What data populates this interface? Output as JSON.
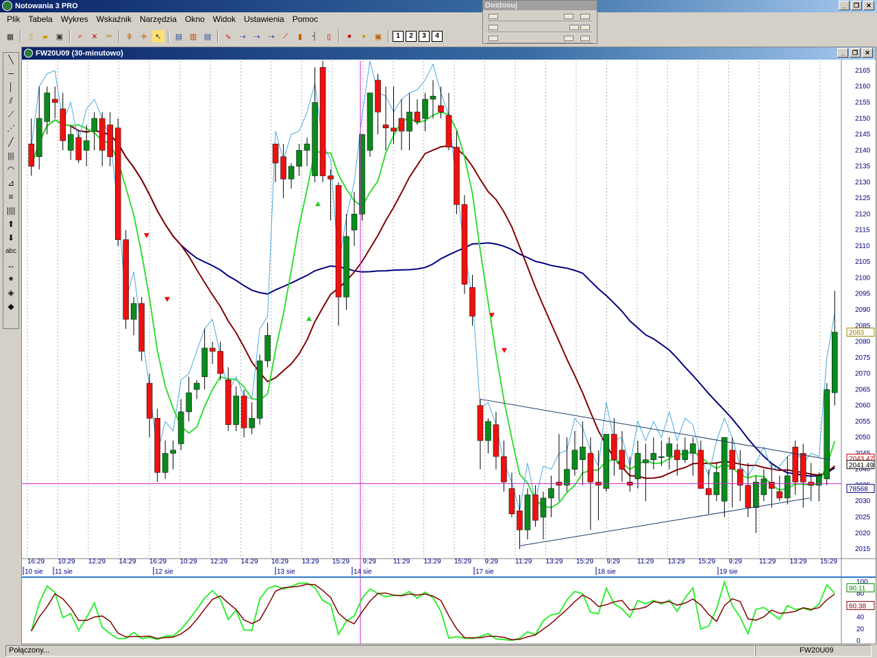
{
  "app": {
    "title": "Notowania 3 PRO",
    "window_buttons": [
      "_",
      "❐",
      "✕"
    ]
  },
  "menu": [
    "Plik",
    "Tabela",
    "Wykres",
    "Wskaźnik",
    "Narzędzia",
    "Okno",
    "Widok",
    "Ustawienia",
    "Pomoc"
  ],
  "toolbar": {
    "icons": [
      "grid-icon",
      "new-icon",
      "open-icon",
      "save-icon",
      "zoom-icon",
      "delete-icon",
      "ruler-icon",
      "fibonacci-icon",
      "crosshair-icon",
      "cursor-icon",
      "table-icon",
      "layout-icon",
      "list-icon",
      "wave-icon",
      "arrow-right-icon",
      "arrow-right-2-icon",
      "arrow-right-3-icon",
      "line-chart-icon",
      "bar-chart-icon",
      "ohlc-icon",
      "candle-icon",
      "signal-icon",
      "idea-icon",
      "picture-icon"
    ],
    "numbers": [
      "1",
      "2",
      "3",
      "4"
    ]
  },
  "adjust_panel": {
    "title": "Dostosuj"
  },
  "left_tools": [
    "line-icon",
    "horizontal-line-icon",
    "vertical-line-icon",
    "channel-icon",
    "trend-icon",
    "gann-fan-icon",
    "segment-icon",
    "parallel-lines-icon",
    "arc-icon",
    "fan-icon",
    "fibonacci-retracement-icon",
    "time-zones-icon",
    "arrow-up-icon",
    "arrow-down-icon",
    "text-icon",
    "measure-icon",
    "magnet-icon",
    "eraser-icon",
    "clear-icon"
  ],
  "chart_window": {
    "title": "FW20U09 (30-minutowo)",
    "window_buttons": [
      "_",
      "❐",
      "✕"
    ]
  },
  "chart_data": {
    "type": "candlestick",
    "instrument": "FW20U09",
    "interval": "30-minutowo",
    "ylim": [
      2012,
      2168
    ],
    "yticks": [
      2165,
      2160,
      2155,
      2150,
      2145,
      2140,
      2135,
      2130,
      2125,
      2120,
      2115,
      2110,
      2105,
      2100,
      2095,
      2090,
      2085,
      2080,
      2075,
      2070,
      2065,
      2060,
      2055,
      2050,
      2045,
      2040,
      2035,
      2030,
      2025,
      2020,
      2015
    ],
    "time_labels": [
      "16:29",
      "10:29",
      "12:29",
      "14:29",
      "16:29",
      "10:29",
      "12:29",
      "14:29",
      "16:29",
      "13:29",
      "15:29",
      "9:29",
      "11:29",
      "13:29",
      "15:29",
      "9:29",
      "11:29",
      "13:29",
      "15:29",
      "9:29",
      "11:29",
      "13:29",
      "15:29",
      "9:29",
      "11:29",
      "13:29",
      "15:29"
    ],
    "date_labels": [
      "10 sie",
      "11 sie",
      "12 sie",
      "13 sie",
      "14 sie",
      "17 sie",
      "18 sie",
      "19 sie"
    ],
    "price_badges": {
      "last": "2083",
      "ma_red": "2043.47",
      "ma_black": "2041.49",
      "volume": "78568"
    },
    "candles": [
      [
        2142,
        2150,
        2132,
        2135
      ],
      [
        2138,
        2160,
        2134,
        2150
      ],
      [
        2149,
        2160,
        2145,
        2158
      ],
      [
        2156,
        2160,
        2150,
        2155
      ],
      [
        2153,
        2158,
        2140,
        2143
      ],
      [
        2140,
        2148,
        2137,
        2145
      ],
      [
        2144,
        2146,
        2136,
        2137
      ],
      [
        2140,
        2148,
        2135,
        2143
      ],
      [
        2146,
        2152,
        2140,
        2150
      ],
      [
        2150,
        2152,
        2135,
        2140
      ],
      [
        2148,
        2152,
        2135,
        2138
      ],
      [
        2147,
        2150,
        2110,
        2112
      ],
      [
        2112,
        2115,
        2084,
        2087
      ],
      [
        2087,
        2094,
        2082,
        2092
      ],
      [
        2092,
        2094,
        2074,
        2077
      ],
      [
        2067,
        2070,
        2050,
        2056
      ],
      [
        2056,
        2059,
        2036,
        2039
      ],
      [
        2039,
        2049,
        2037,
        2045
      ],
      [
        2045,
        2049,
        2040,
        2046
      ],
      [
        2048,
        2062,
        2046,
        2058
      ],
      [
        2058,
        2069,
        2055,
        2064
      ],
      [
        2065,
        2068,
        2062,
        2067
      ],
      [
        2069,
        2084,
        2065,
        2078
      ],
      [
        2078,
        2080,
        2073,
        2077
      ],
      [
        2077,
        2080,
        2068,
        2070
      ],
      [
        2068,
        2072,
        2052,
        2054
      ],
      [
        2054,
        2066,
        2052,
        2063
      ],
      [
        2063,
        2065,
        2050,
        2053
      ],
      [
        2053,
        2061,
        2051,
        2056
      ],
      [
        2056,
        2076,
        2054,
        2074
      ],
      [
        2074,
        2086,
        2072,
        2082
      ],
      [
        2142,
        2142,
        2130,
        2136
      ],
      [
        2138,
        2142,
        2125,
        2131
      ],
      [
        2131,
        2136,
        2128,
        2135
      ],
      [
        2135,
        2142,
        2132,
        2140
      ],
      [
        2140,
        2144,
        2135,
        2142
      ],
      [
        2132,
        2166,
        2130,
        2155
      ],
      [
        2166,
        2168,
        2130,
        2132
      ],
      [
        2132,
        2134,
        2118,
        2131
      ],
      [
        2129,
        2130,
        2085,
        2094
      ],
      [
        2094,
        2120,
        2090,
        2113
      ],
      [
        2115,
        2127,
        2110,
        2120
      ],
      [
        2120,
        2144,
        2118,
        2145
      ],
      [
        2140,
        2158,
        2138,
        2158
      ],
      [
        2162,
        2164,
        2145,
        2152
      ],
      [
        2148,
        2160,
        2140,
        2147
      ],
      [
        2147,
        2160,
        2142,
        2146
      ],
      [
        2150,
        2156,
        2140,
        2146
      ],
      [
        2146,
        2158,
        2140,
        2152
      ],
      [
        2152,
        2156,
        2148,
        2149
      ],
      [
        2150,
        2158,
        2146,
        2156
      ],
      [
        2156,
        2162,
        2150,
        2157
      ],
      [
        2154,
        2160,
        2150,
        2152
      ],
      [
        2151,
        2158,
        2140,
        2141
      ],
      [
        2141,
        2146,
        2120,
        2123
      ],
      [
        2123,
        2126,
        2095,
        2098
      ],
      [
        2097,
        2101,
        2085,
        2088
      ],
      [
        2060,
        2062,
        2040,
        2049
      ],
      [
        2049,
        2056,
        2045,
        2055
      ],
      [
        2054,
        2058,
        2040,
        2044
      ],
      [
        2044,
        2049,
        2033,
        2036
      ],
      [
        2034,
        2039,
        2025,
        2026
      ],
      [
        2027,
        2032,
        2015,
        2021
      ],
      [
        2021,
        2034,
        2018,
        2032
      ],
      [
        2032,
        2035,
        2022,
        2024
      ],
      [
        2025,
        2033,
        2018,
        2031
      ],
      [
        2031,
        2038,
        2025,
        2034
      ],
      [
        2036,
        2051,
        2030,
        2035
      ],
      [
        2035,
        2050,
        2033,
        2040
      ],
      [
        2040,
        2052,
        2038,
        2046
      ],
      [
        2043,
        2055,
        2035,
        2047
      ],
      [
        2045,
        2050,
        2021,
        2036
      ],
      [
        2036,
        2046,
        2024,
        2035
      ],
      [
        2034,
        2050,
        2033,
        2051
      ],
      [
        2051,
        2056,
        2038,
        2043
      ],
      [
        2046,
        2052,
        2036,
        2040
      ],
      [
        2036,
        2044,
        2033,
        2035
      ],
      [
        2037,
        2049,
        2034,
        2045
      ],
      [
        2042,
        2048,
        2030,
        2043
      ],
      [
        2043,
        2050,
        2040,
        2045
      ],
      [
        2044,
        2049,
        2041,
        2044
      ],
      [
        2044,
        2050,
        2040,
        2048
      ],
      [
        2046,
        2048,
        2038,
        2043
      ],
      [
        2043,
        2050,
        2042,
        2046
      ],
      [
        2045,
        2050,
        2038,
        2048
      ],
      [
        2046,
        2049,
        2034,
        2034
      ],
      [
        2034,
        2040,
        2026,
        2032
      ],
      [
        2032,
        2042,
        2030,
        2039
      ],
      [
        2030,
        2050,
        2025,
        2050
      ],
      [
        2046,
        2050,
        2028,
        2040
      ],
      [
        2040,
        2046,
        2030,
        2035
      ],
      [
        2035,
        2042,
        2025,
        2028
      ],
      [
        2028,
        2038,
        2020,
        2036
      ],
      [
        2032,
        2040,
        2030,
        2037
      ],
      [
        2036,
        2042,
        2028,
        2034
      ],
      [
        2033,
        2038,
        2030,
        2031
      ],
      [
        2031,
        2044,
        2029,
        2038
      ],
      [
        2047,
        2049,
        2032,
        2036
      ],
      [
        2045,
        2048,
        2028,
        2036
      ],
      [
        2036,
        2042,
        2030,
        2035
      ],
      [
        2035,
        2039,
        2030,
        2038
      ],
      [
        2037,
        2067,
        2035,
        2065
      ],
      [
        2064,
        2096,
        2060,
        2083
      ]
    ],
    "oscillator": {
      "ylim": [
        0,
        100
      ],
      "yticks": [
        100,
        80,
        60,
        40,
        20,
        0
      ],
      "badges": [
        "90.11",
        "60.38"
      ]
    }
  },
  "status": {
    "left": "Połączony...",
    "right": "FW20U09"
  }
}
